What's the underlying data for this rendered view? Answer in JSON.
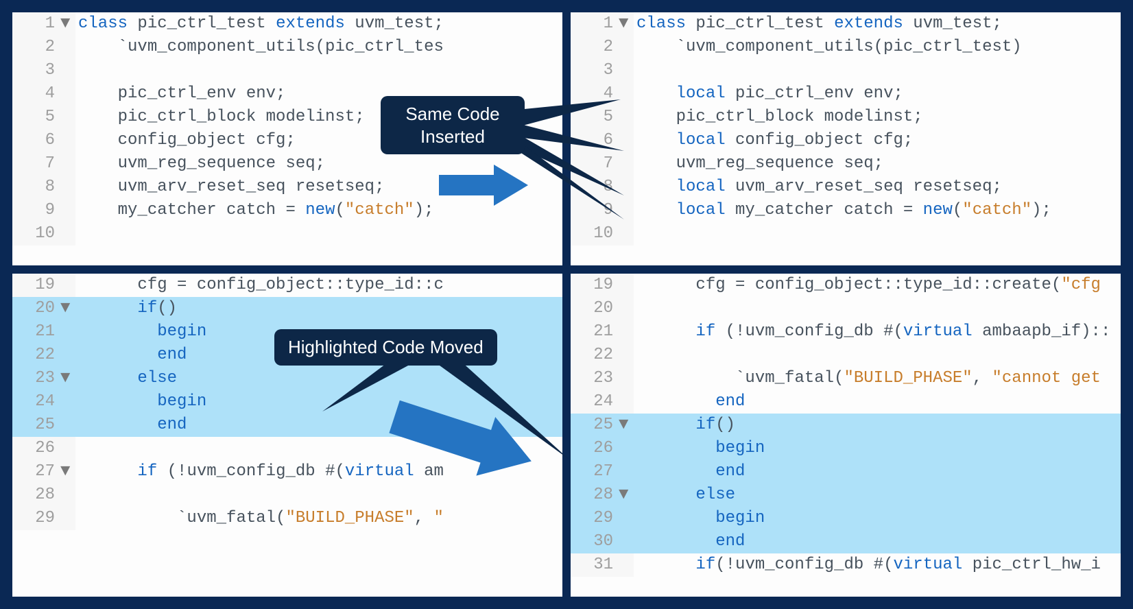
{
  "panels": {
    "topLeft": {
      "lines": [
        {
          "n": "1",
          "fold": "▼",
          "hl": false,
          "tokens": [
            [
              "kw",
              "class"
            ],
            [
              "txt",
              " pic_ctrl_test "
            ],
            [
              "kw",
              "extends"
            ],
            [
              "txt",
              " uvm_test;"
            ]
          ]
        },
        {
          "n": "2",
          "fold": "",
          "hl": false,
          "tokens": [
            [
              "txt",
              "    `uvm_component_utils(pic_ctrl_tes"
            ]
          ]
        },
        {
          "n": "3",
          "fold": "",
          "hl": false,
          "tokens": [
            [
              "txt",
              ""
            ]
          ]
        },
        {
          "n": "4",
          "fold": "",
          "hl": false,
          "tokens": [
            [
              "txt",
              "    pic_ctrl_env env;"
            ]
          ]
        },
        {
          "n": "5",
          "fold": "",
          "hl": false,
          "tokens": [
            [
              "txt",
              "    pic_ctrl_block modelinst;"
            ]
          ]
        },
        {
          "n": "6",
          "fold": "",
          "hl": false,
          "tokens": [
            [
              "txt",
              "    config_object cfg;"
            ]
          ]
        },
        {
          "n": "7",
          "fold": "",
          "hl": false,
          "tokens": [
            [
              "txt",
              "    uvm_reg_sequence seq;"
            ]
          ]
        },
        {
          "n": "8",
          "fold": "",
          "hl": false,
          "tokens": [
            [
              "txt",
              "    uvm_arv_reset_seq resetseq;"
            ]
          ]
        },
        {
          "n": "9",
          "fold": "",
          "hl": false,
          "tokens": [
            [
              "txt",
              "    my_catcher catch = "
            ],
            [
              "kw",
              "new"
            ],
            [
              "txt",
              "("
            ],
            [
              "str",
              "\"catch\""
            ],
            [
              "txt",
              ");"
            ]
          ]
        },
        {
          "n": "10",
          "fold": "",
          "hl": false,
          "tokens": [
            [
              "txt",
              ""
            ]
          ]
        }
      ]
    },
    "topRight": {
      "lines": [
        {
          "n": "1",
          "fold": "▼",
          "hl": false,
          "tokens": [
            [
              "kw",
              "class"
            ],
            [
              "txt",
              " pic_ctrl_test "
            ],
            [
              "kw",
              "extends"
            ],
            [
              "txt",
              " uvm_test;"
            ]
          ]
        },
        {
          "n": "2",
          "fold": "",
          "hl": false,
          "tokens": [
            [
              "txt",
              "    `uvm_component_utils(pic_ctrl_test)"
            ]
          ]
        },
        {
          "n": "3",
          "fold": "",
          "hl": false,
          "tokens": [
            [
              "txt",
              ""
            ]
          ]
        },
        {
          "n": "4",
          "fold": "",
          "hl": false,
          "tokens": [
            [
              "txt",
              "    "
            ],
            [
              "kw",
              "local"
            ],
            [
              "txt",
              " pic_ctrl_env env;"
            ]
          ]
        },
        {
          "n": "5",
          "fold": "",
          "hl": false,
          "tokens": [
            [
              "txt",
              "    pic_ctrl_block modelinst;"
            ]
          ]
        },
        {
          "n": "6",
          "fold": "",
          "hl": false,
          "tokens": [
            [
              "txt",
              "    "
            ],
            [
              "kw",
              "local"
            ],
            [
              "txt",
              " config_object cfg;"
            ]
          ]
        },
        {
          "n": "7",
          "fold": "",
          "hl": false,
          "tokens": [
            [
              "txt",
              "    uvm_reg_sequence seq;"
            ]
          ]
        },
        {
          "n": "8",
          "fold": "",
          "hl": false,
          "tokens": [
            [
              "txt",
              "    "
            ],
            [
              "kw",
              "local"
            ],
            [
              "txt",
              " uvm_arv_reset_seq resetseq;"
            ]
          ]
        },
        {
          "n": "9",
          "fold": "",
          "hl": false,
          "tokens": [
            [
              "txt",
              "    "
            ],
            [
              "kw",
              "local"
            ],
            [
              "txt",
              " my_catcher catch = "
            ],
            [
              "kw",
              "new"
            ],
            [
              "txt",
              "("
            ],
            [
              "str",
              "\"catch\""
            ],
            [
              "txt",
              ");"
            ]
          ]
        },
        {
          "n": "10",
          "fold": "",
          "hl": false,
          "tokens": [
            [
              "txt",
              ""
            ]
          ]
        }
      ]
    },
    "bottomLeft": {
      "lines": [
        {
          "n": "19",
          "fold": "",
          "hl": false,
          "tokens": [
            [
              "txt",
              "      cfg = config_object::type_id::c"
            ]
          ]
        },
        {
          "n": "20",
          "fold": "▼",
          "hl": true,
          "tokens": [
            [
              "txt",
              "      "
            ],
            [
              "kw",
              "if"
            ],
            [
              "txt",
              "()"
            ]
          ]
        },
        {
          "n": "21",
          "fold": "",
          "hl": true,
          "tokens": [
            [
              "txt",
              "        "
            ],
            [
              "kw",
              "begin"
            ]
          ]
        },
        {
          "n": "22",
          "fold": "",
          "hl": true,
          "tokens": [
            [
              "txt",
              "        "
            ],
            [
              "kw",
              "end"
            ]
          ]
        },
        {
          "n": "23",
          "fold": "▼",
          "hl": true,
          "tokens": [
            [
              "txt",
              "      "
            ],
            [
              "kw",
              "else"
            ]
          ]
        },
        {
          "n": "24",
          "fold": "",
          "hl": true,
          "tokens": [
            [
              "txt",
              "        "
            ],
            [
              "kw",
              "begin"
            ]
          ]
        },
        {
          "n": "25",
          "fold": "",
          "hl": true,
          "tokens": [
            [
              "txt",
              "        "
            ],
            [
              "kw",
              "end"
            ]
          ]
        },
        {
          "n": "26",
          "fold": "",
          "hl": false,
          "tokens": [
            [
              "txt",
              ""
            ]
          ]
        },
        {
          "n": "27",
          "fold": "▼",
          "hl": false,
          "tokens": [
            [
              "txt",
              "      "
            ],
            [
              "kw",
              "if"
            ],
            [
              "txt",
              " (!uvm_config_db #("
            ],
            [
              "kw",
              "virtual"
            ],
            [
              "txt",
              " am"
            ]
          ]
        },
        {
          "n": "28",
          "fold": "",
          "hl": false,
          "tokens": [
            [
              "txt",
              ""
            ]
          ]
        },
        {
          "n": "29",
          "fold": "",
          "hl": false,
          "tokens": [
            [
              "txt",
              "          `uvm_fatal("
            ],
            [
              "str",
              "\"BUILD_PHASE\""
            ],
            [
              "txt",
              ", "
            ],
            [
              "str",
              "\""
            ]
          ]
        }
      ]
    },
    "bottomRight": {
      "lines": [
        {
          "n": "19",
          "fold": "",
          "hl": false,
          "tokens": [
            [
              "txt",
              "      cfg = config_object::type_id::create("
            ],
            [
              "str",
              "\"cfg"
            ]
          ]
        },
        {
          "n": "20",
          "fold": "",
          "hl": false,
          "tokens": [
            [
              "txt",
              ""
            ]
          ]
        },
        {
          "n": "21",
          "fold": "",
          "hl": false,
          "tokens": [
            [
              "txt",
              "      "
            ],
            [
              "kw",
              "if"
            ],
            [
              "txt",
              " (!uvm_config_db #("
            ],
            [
              "kw",
              "virtual"
            ],
            [
              "txt",
              " ambaapb_if)::"
            ]
          ]
        },
        {
          "n": "22",
          "fold": "",
          "hl": false,
          "tokens": [
            [
              "txt",
              ""
            ]
          ]
        },
        {
          "n": "23",
          "fold": "",
          "hl": false,
          "tokens": [
            [
              "txt",
              "          `uvm_fatal("
            ],
            [
              "str",
              "\"BUILD_PHASE\""
            ],
            [
              "txt",
              ", "
            ],
            [
              "str",
              "\"cannot get "
            ]
          ]
        },
        {
          "n": "24",
          "fold": "",
          "hl": false,
          "tokens": [
            [
              "txt",
              "        "
            ],
            [
              "kw",
              "end"
            ]
          ]
        },
        {
          "n": "25",
          "fold": "▼",
          "hl": true,
          "tokens": [
            [
              "txt",
              "      "
            ],
            [
              "kw",
              "if"
            ],
            [
              "txt",
              "()"
            ]
          ]
        },
        {
          "n": "26",
          "fold": "",
          "hl": true,
          "tokens": [
            [
              "txt",
              "        "
            ],
            [
              "kw",
              "begin"
            ]
          ]
        },
        {
          "n": "27",
          "fold": "",
          "hl": true,
          "tokens": [
            [
              "txt",
              "        "
            ],
            [
              "kw",
              "end"
            ]
          ]
        },
        {
          "n": "28",
          "fold": "▼",
          "hl": true,
          "tokens": [
            [
              "txt",
              "      "
            ],
            [
              "kw",
              "else"
            ]
          ]
        },
        {
          "n": "29",
          "fold": "",
          "hl": true,
          "tokens": [
            [
              "txt",
              "        "
            ],
            [
              "kw",
              "begin"
            ]
          ]
        },
        {
          "n": "30",
          "fold": "",
          "hl": true,
          "tokens": [
            [
              "txt",
              "        "
            ],
            [
              "kw",
              "end"
            ]
          ]
        },
        {
          "n": "31",
          "fold": "",
          "hl": false,
          "tokens": [
            [
              "txt",
              "      "
            ],
            [
              "kw",
              "if"
            ],
            [
              "txt",
              "(!uvm_config_db #("
            ],
            [
              "kw",
              "virtual"
            ],
            [
              "txt",
              " pic_ctrl_hw_i"
            ]
          ]
        }
      ]
    }
  },
  "annotations": {
    "callout1_line1": "Same Code",
    "callout1_line2": "Inserted",
    "callout2": "Highlighted Code Moved"
  }
}
